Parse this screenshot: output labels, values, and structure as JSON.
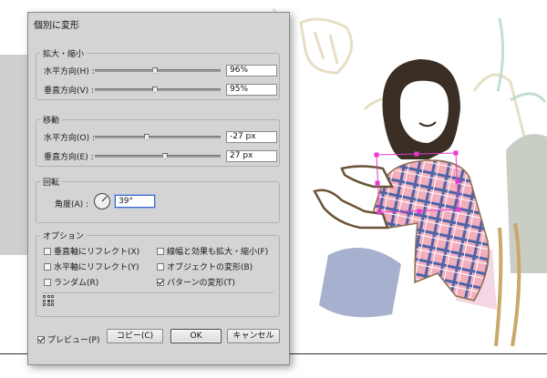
{
  "dialog": {
    "title": "個別に変形",
    "scale": {
      "title": "拡大・縮小",
      "horizontal": {
        "label": "水平方向(H) :",
        "value": "96%",
        "slider_fraction": 0.48
      },
      "vertical": {
        "label": "垂直方向(V) :",
        "value": "95%",
        "slider_fraction": 0.475
      }
    },
    "move": {
      "title": "移動",
      "horizontal": {
        "label": "水平方向(O) :",
        "value": "-27 px",
        "slider_fraction": 0.41
      },
      "vertical": {
        "label": "垂直方向(E) :",
        "value": "27 px",
        "slider_fraction": 0.56
      }
    },
    "rotate": {
      "title": "回転",
      "angle_label": "角度(A) :",
      "angle_value": "39°"
    },
    "options": {
      "title": "オプション",
      "reflect_x": {
        "label": "垂直軸にリフレクト(X)",
        "checked": false
      },
      "reflect_y": {
        "label": "水平軸にリフレクト(Y)",
        "checked": false
      },
      "random": {
        "label": "ランダム(R)",
        "checked": false
      },
      "scale_strokes": {
        "label": "線幅と効果も拡大・縮小(F)",
        "checked": false
      },
      "transform_objects": {
        "label": "オブジェクトの変形(B)",
        "checked": false
      },
      "transform_patterns": {
        "label": "パターンの変形(T)",
        "checked": true
      }
    },
    "preview": {
      "label": "プレビュー(P)",
      "checked": true
    },
    "buttons": {
      "copy": "コピー(C)",
      "ok": "OK",
      "cancel": "キャンセル"
    }
  },
  "colors": {
    "dialog_bg": "#d4d4d4",
    "hair": "#3b2e24",
    "plaid_pink": "#f2aebc",
    "plaid_blue": "#4e63a8",
    "selection": "#e43ad0",
    "arm_outline": "#6a5538"
  }
}
